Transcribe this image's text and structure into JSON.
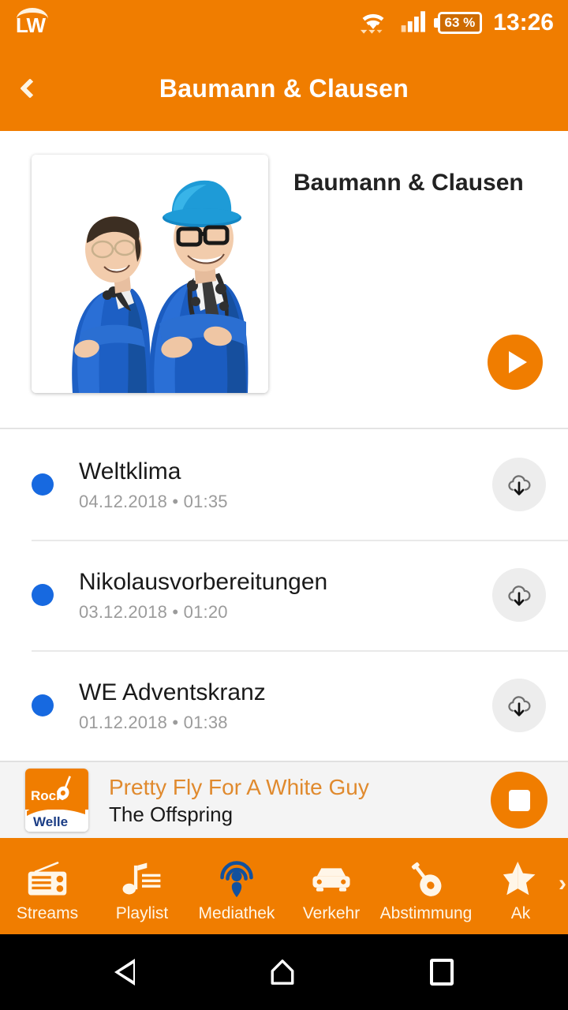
{
  "status_bar": {
    "app_logo_text": "LW",
    "app_logo_icon": "lw-brand-icon",
    "wifi_icon": "wifi-icon",
    "signal_icon": "cellular-signal-icon",
    "battery_level": "63 %",
    "time": "13:26"
  },
  "app_bar": {
    "back_icon": "chevron-left-icon",
    "title": "Baumann & Clausen"
  },
  "header": {
    "cover_alt": "Baumann & Clausen cover photo",
    "show_title": "Baumann & Clausen",
    "play_icon": "play-icon"
  },
  "episodes": {
    "download_icon": "cloud-download-icon",
    "items": [
      {
        "title": "Weltklima",
        "date": "04.12.2018",
        "separator": "•",
        "duration": "01:35",
        "meta": "04.12.2018 • 01:35"
      },
      {
        "title": "Nikolausvorbereitungen",
        "date": "03.12.2018",
        "separator": "•",
        "duration": "01:20",
        "meta": "03.12.2018 • 01:20"
      },
      {
        "title": "WE Adventskranz",
        "date": "01.12.2018",
        "separator": "•",
        "duration": "01:38",
        "meta": "01.12.2018 • 01:38"
      }
    ]
  },
  "now_playing": {
    "station_logo_line1": "Rock",
    "station_logo_line2": "Welle",
    "station_logo_icon": "rock-welle-logo",
    "track_title": "Pretty Fly For A White Guy",
    "artist": "The Offspring",
    "stop_icon": "stop-icon"
  },
  "bottom_nav": {
    "scroll_indicator": "›",
    "items": [
      {
        "label": "Streams",
        "icon": "radio-icon"
      },
      {
        "label": "Playlist",
        "icon": "music-note-list-icon"
      },
      {
        "label": "Mediathek",
        "icon": "podcast-icon"
      },
      {
        "label": "Verkehr",
        "icon": "car-icon"
      },
      {
        "label": "Abstimmung",
        "icon": "guitar-icon"
      },
      {
        "label": "Ak",
        "icon": "star-icon"
      }
    ]
  },
  "android_nav": {
    "back_icon": "android-back-icon",
    "home_icon": "android-home-icon",
    "recents_icon": "android-recents-icon"
  },
  "colors": {
    "brand_orange": "#F07D00",
    "accent_blue": "#1769E0",
    "track_title_orange": "#E08A2E",
    "nav_active_blue": "#12519E"
  }
}
